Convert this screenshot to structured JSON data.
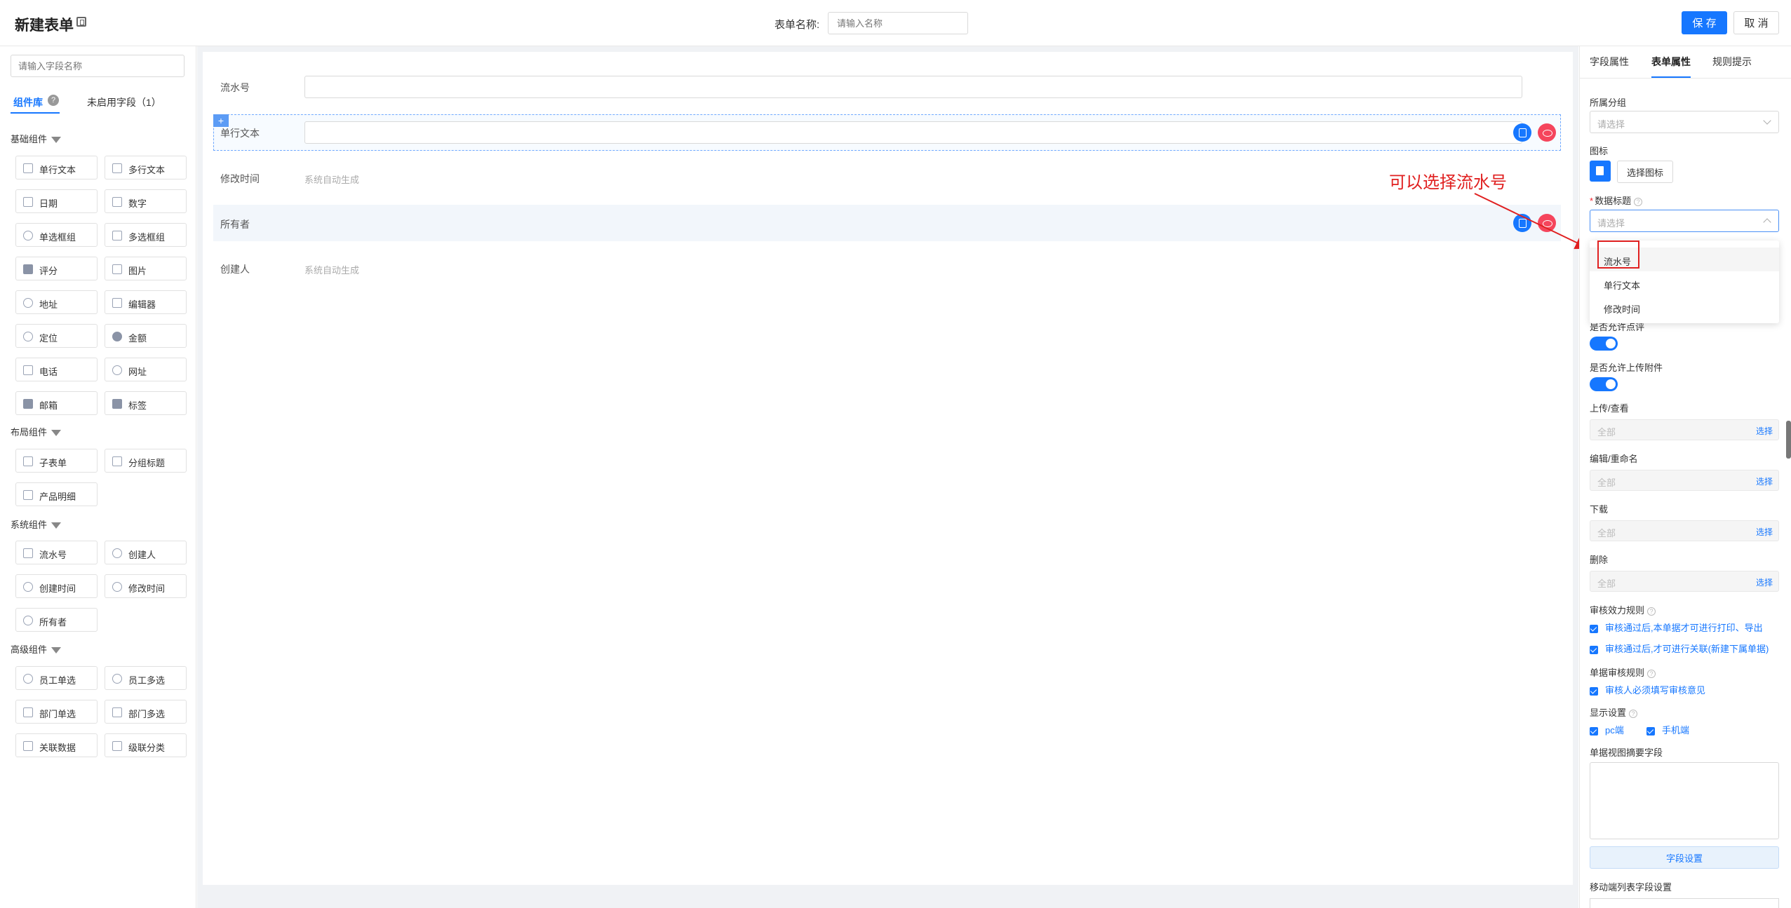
{
  "header": {
    "title": "新建表单",
    "form_name_label": "表单名称:",
    "form_name_placeholder": "请输入名称",
    "save_label": "保 存",
    "cancel_label": "取 消"
  },
  "left_panel": {
    "search_placeholder": "请输入字段名称",
    "tab_library": "组件库",
    "tab_library_help": "?",
    "tab_unused": "未启用字段（1）",
    "groups": {
      "basic": "基础组件",
      "layout": "布局组件",
      "system": "系统组件",
      "advanced": "高级组件"
    },
    "basic_items": [
      "单行文本",
      "多行文本",
      "日期",
      "数字",
      "单选框组",
      "多选框组",
      "评分",
      "图片",
      "地址",
      "编辑器",
      "定位",
      "金额",
      "电话",
      "网址",
      "邮箱",
      "标签"
    ],
    "layout_items": [
      "子表单",
      "分组标题",
      "产品明细"
    ],
    "system_items": [
      "流水号",
      "创建人",
      "创建时间",
      "修改时间",
      "所有者"
    ],
    "advanced_items": [
      "员工单选",
      "员工多选",
      "部门单选",
      "部门多选",
      "关联数据",
      "级联分类"
    ]
  },
  "canvas": {
    "rows": [
      {
        "label": "流水号",
        "value": ""
      },
      {
        "label": "单行文本",
        "value": ""
      },
      {
        "label": "修改时间",
        "value": "系统自动生成"
      },
      {
        "label": "所有者",
        "value": ""
      },
      {
        "label": "创建人",
        "value": "系统自动生成"
      }
    ],
    "drag_handle": "+"
  },
  "annotation": {
    "text": "可以选择流水号",
    "color": "#e02020"
  },
  "right_panel": {
    "tabs": [
      "字段属性",
      "表单属性",
      "规则提示"
    ],
    "active_tab": "表单属性",
    "group_label": "所属分组",
    "group_placeholder": "请选择",
    "icon_label": "图标",
    "choose_icon_label": "选择图标",
    "data_title_label": "数据标题",
    "data_title_required": "*",
    "data_title_placeholder": "请选择",
    "dropdown_options": [
      "流水号",
      "单行文本",
      "修改时间"
    ],
    "allow_comment_label": "是否允许点评",
    "allow_attachment_label": "是否允许上传附件",
    "perms": [
      {
        "label": "上传/查看",
        "value": "全部",
        "action": "选择"
      },
      {
        "label": "编辑/重命名",
        "value": "全部",
        "action": "选择"
      },
      {
        "label": "下载",
        "value": "全部",
        "action": "选择"
      },
      {
        "label": "删除",
        "value": "全部",
        "action": "选择"
      }
    ],
    "audit_rule_label": "审核效力规则",
    "audit_rule_options": [
      "审核通过后,本单据才可进行打印、导出",
      "审核通过后,才可进行关联(新建下属单据)"
    ],
    "doc_audit_label": "单据审核规则",
    "doc_audit_options": [
      "审核人必须填写审核意见"
    ],
    "display_label": "显示设置",
    "display_options": [
      "pc端",
      "手机端"
    ],
    "summary_label": "单据视图摘要字段",
    "field_settings_label": "字段设置",
    "mobile_list_label": "移动端列表字段设置",
    "help_glyph": "?"
  },
  "colors": {
    "primary": "#1677ff",
    "danger": "#f5455c",
    "annotation": "#e02020"
  }
}
